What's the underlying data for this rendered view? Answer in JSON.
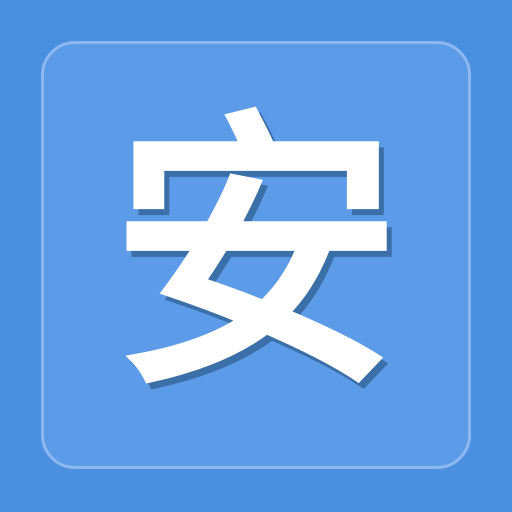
{
  "icon": {
    "character": "安",
    "colors": {
      "background": "#4b8fe1",
      "tile": "#5c9be7",
      "tile_border": "#8db8ef",
      "glyph": "#ffffff",
      "glyph_shadow": "#3b6fa8"
    }
  }
}
